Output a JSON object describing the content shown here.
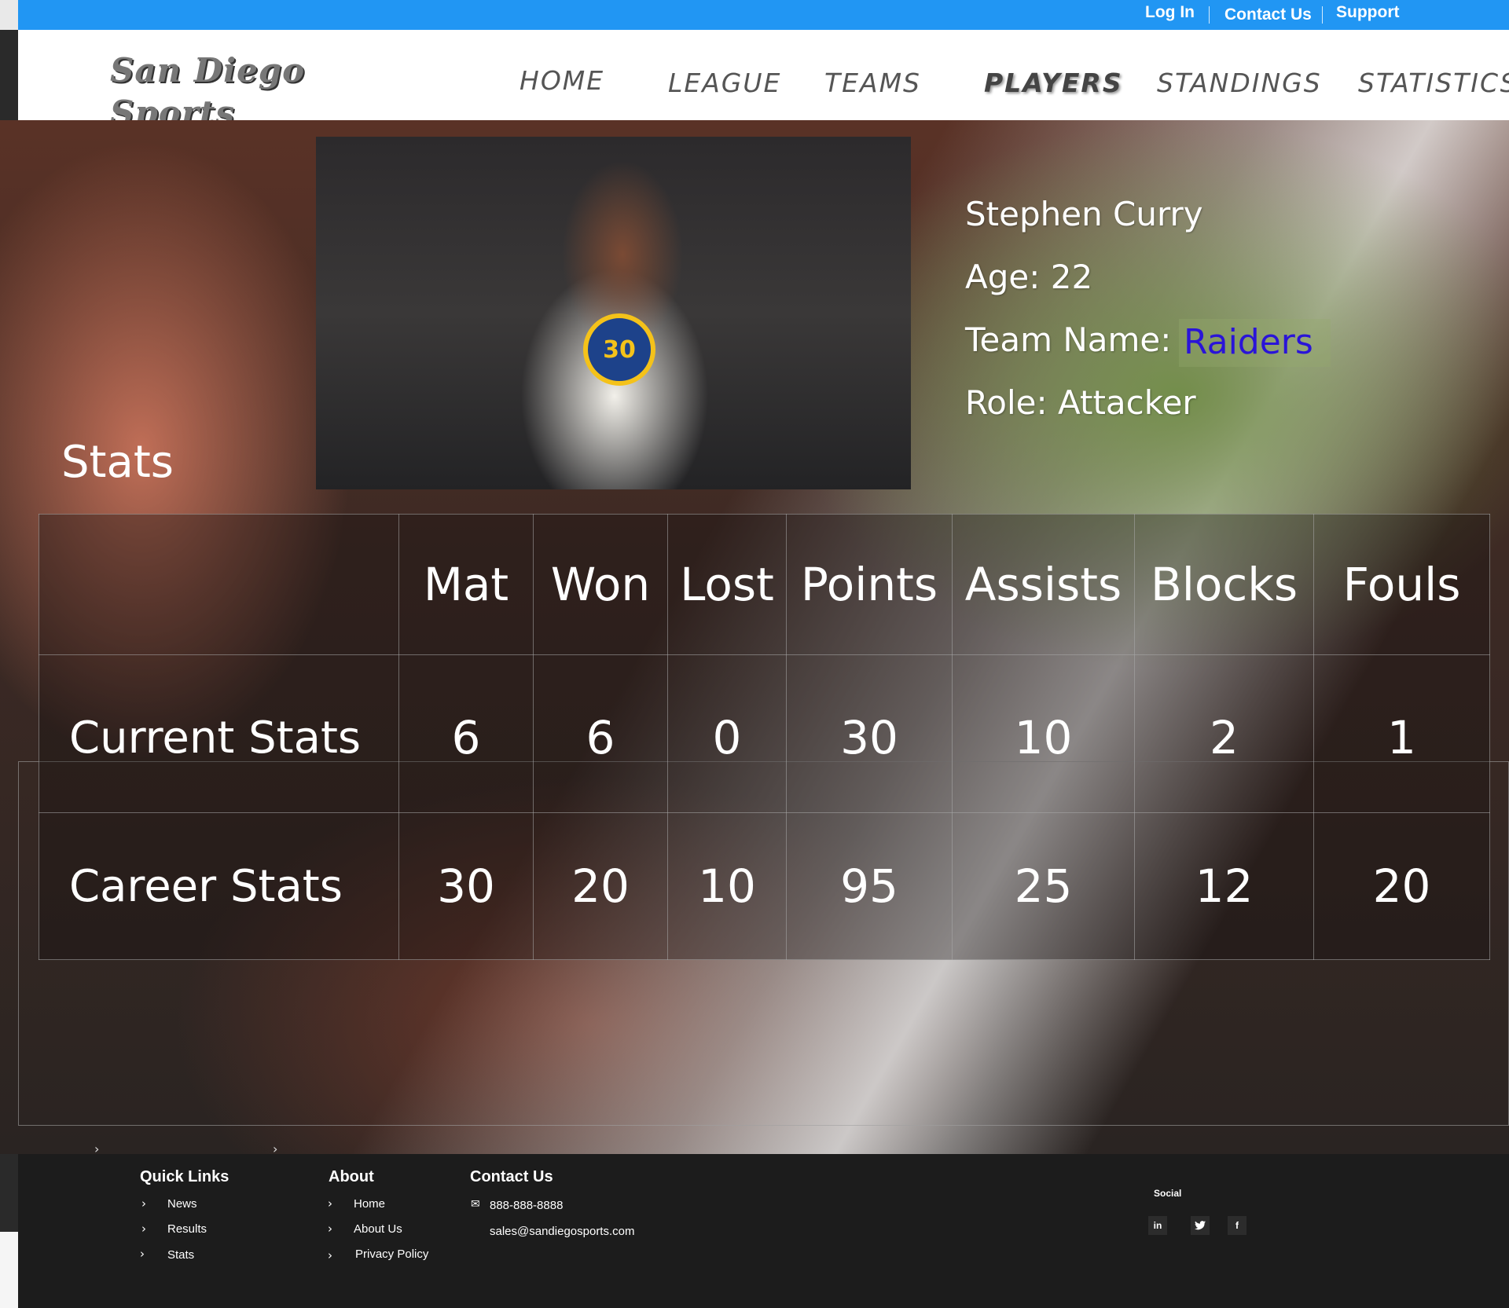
{
  "topbar": {
    "login": "Log In",
    "contact": "Contact Us",
    "support": "Support"
  },
  "brand": {
    "line1": "San Diego",
    "line2": "Sports"
  },
  "nav": {
    "home": "HOME",
    "league": "LEAGUE",
    "teams": "TEAMS",
    "players": "PLAYERS",
    "standings": "STANDINGS",
    "statistics": "STATISTICS"
  },
  "player": {
    "name": "Stephen Curry",
    "age": "Age: 22",
    "team_label": "Team Name:",
    "team_value": "Raiders",
    "role": "Role: Attacker",
    "jersey_number": "30"
  },
  "stats": {
    "heading": "Stats",
    "columns": [
      "Mat",
      "Won",
      "Lost",
      "Points",
      "Assists",
      "Blocks",
      "Fouls"
    ],
    "rows": [
      {
        "label": "Current Stats",
        "values": [
          "6",
          "6",
          "0",
          "30",
          "10",
          "2",
          "1"
        ]
      },
      {
        "label": "Career Stats",
        "values": [
          "30",
          "20",
          "10",
          "95",
          "25",
          "12",
          "20"
        ]
      }
    ]
  },
  "footer": {
    "quick_links": {
      "title": "Quick Links",
      "items": [
        "News",
        "Results",
        "Stats"
      ]
    },
    "about": {
      "title": "About",
      "items": [
        "Home",
        "About Us",
        "Privacy Policy"
      ]
    },
    "contact": {
      "title": "Contact Us",
      "phone": "888-888-8888",
      "email": "sales@sandiegosports.com"
    },
    "social": {
      "title": "Social",
      "icons": [
        "linkedin-icon",
        "twitter-icon",
        "facebook-icon"
      ]
    }
  },
  "colors": {
    "topbar": "#2196f3",
    "team_link": "#2a14d8",
    "footer": "#1c1c1c"
  }
}
